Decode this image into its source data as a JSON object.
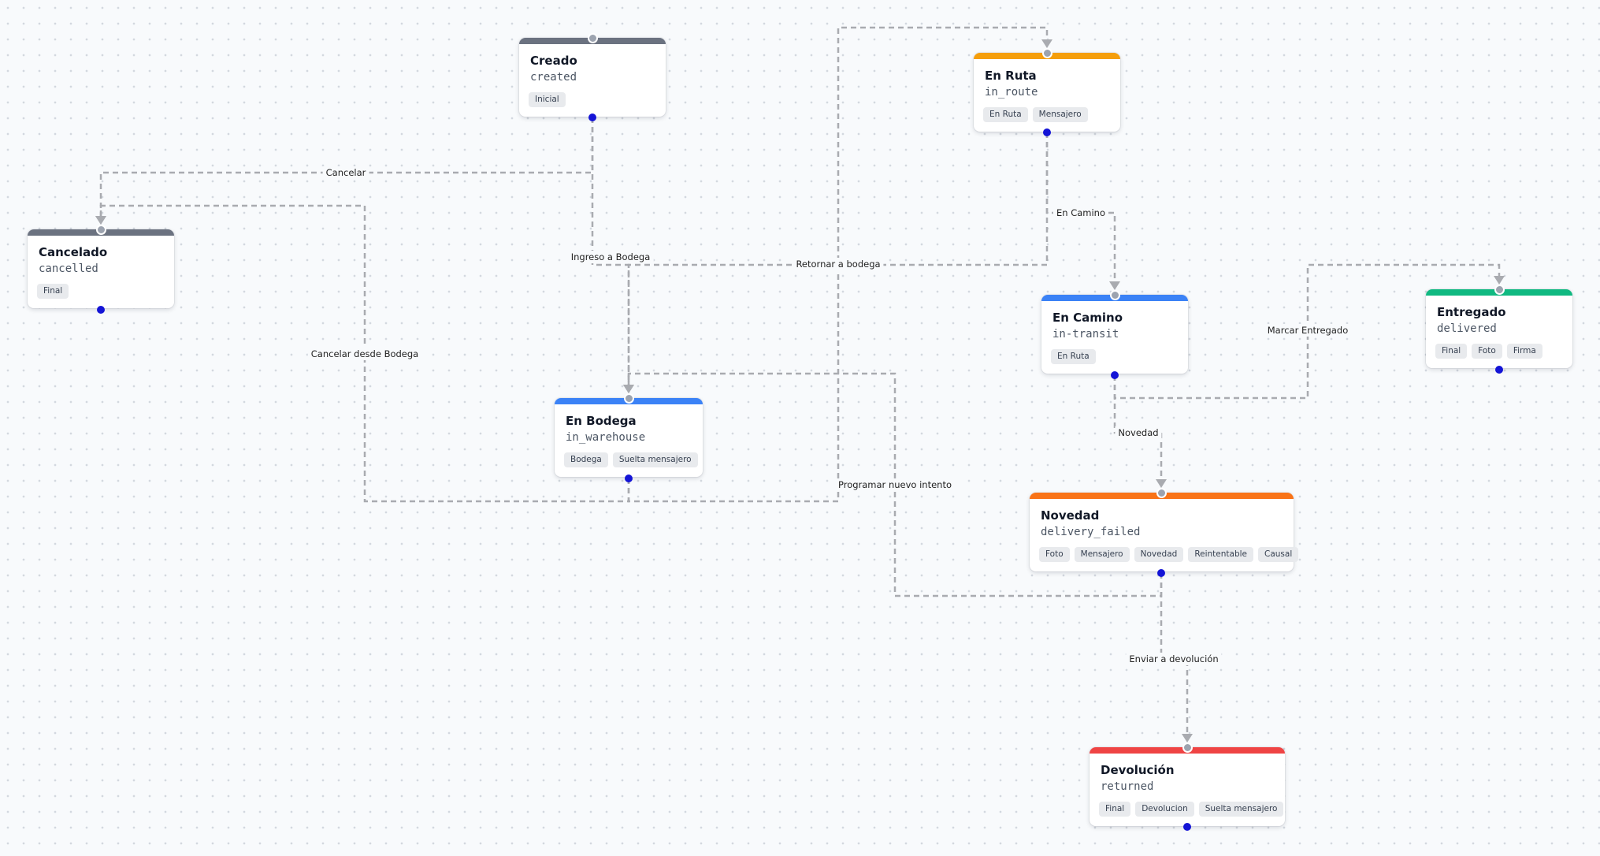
{
  "nodes": {
    "created": {
      "title": "Creado",
      "code": "created",
      "color": "#6b7280",
      "tags": [
        "Inicial"
      ]
    },
    "in_route": {
      "title": "En Ruta",
      "code": "in_route",
      "color": "#f59e0b",
      "tags": [
        "En Ruta",
        "Mensajero"
      ]
    },
    "cancelled": {
      "title": "Cancelado",
      "code": "cancelled",
      "color": "#6b7280",
      "tags": [
        "Final"
      ]
    },
    "in_transit": {
      "title": "En Camino",
      "code": "in-transit",
      "color": "#3b82f6",
      "tags": [
        "En Ruta"
      ]
    },
    "delivered": {
      "title": "Entregado",
      "code": "delivered",
      "color": "#10b981",
      "tags": [
        "Final",
        "Foto",
        "Firma"
      ]
    },
    "in_warehouse": {
      "title": "En Bodega",
      "code": "in_warehouse",
      "color": "#3b82f6",
      "tags": [
        "Bodega",
        "Suelta mensajero"
      ]
    },
    "delivery_failed": {
      "title": "Novedad",
      "code": "delivery_failed",
      "color": "#f97316",
      "tags": [
        "Foto",
        "Mensajero",
        "Novedad",
        "Reintentable",
        "Causal"
      ]
    },
    "returned": {
      "title": "Devolución",
      "code": "returned",
      "color": "#ef4444",
      "tags": [
        "Final",
        "Devolucion",
        "Suelta mensajero"
      ]
    }
  },
  "edges": {
    "cancel": {
      "label": "Cancelar"
    },
    "to_warehouse": {
      "label": "Ingreso a Bodega"
    },
    "return_warehouse": {
      "label": "Retornar a bodega"
    },
    "en_camino": {
      "label": "En Camino"
    },
    "mark_delivered": {
      "label": "Marcar Entregado"
    },
    "cancel_warehouse": {
      "label": "Cancelar desde Bodega"
    },
    "novedad": {
      "label": "Novedad"
    },
    "retry": {
      "label": "Programar nuevo intento"
    },
    "send_return": {
      "label": "Enviar a devolución"
    }
  },
  "colors": {
    "edge": "#a9abb0",
    "handle_out": "#1414d6",
    "handle_in": "#9ca3af"
  }
}
